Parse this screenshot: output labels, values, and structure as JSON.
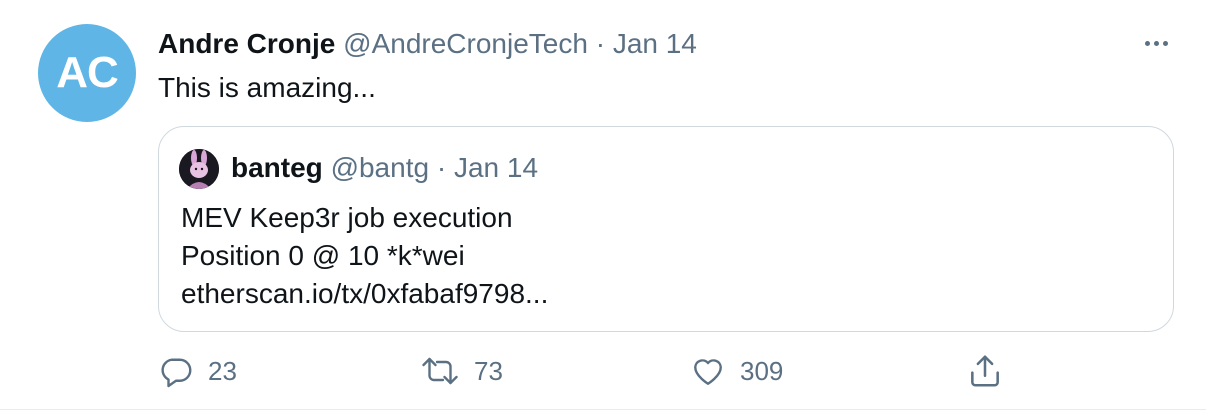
{
  "tweet": {
    "avatar_initials": "AC",
    "avatar_color": "#5fb5e5",
    "author_name": "Andre Cronje",
    "author_handle": "@AndreCronjeTech",
    "separator": "·",
    "date": "Jan 14",
    "text": "This is amazing..."
  },
  "quoted_tweet": {
    "avatar_icon": "bunny-avatar-icon",
    "author_name": "banteg",
    "author_handle": "@bantg",
    "separator": "·",
    "date": "Jan 14",
    "lines": [
      "MEV Keep3r job execution",
      "Position 0 @ 10 *k*wei",
      "etherscan.io/tx/0xfabaf9798..."
    ]
  },
  "actions": {
    "reply": {
      "icon": "reply-icon",
      "count": "23"
    },
    "retweet": {
      "icon": "retweet-icon",
      "count": "73"
    },
    "like": {
      "icon": "heart-icon",
      "count": "309"
    },
    "share": {
      "icon": "share-icon"
    }
  },
  "colors": {
    "text": "#0f1419",
    "secondary": "#5b7083",
    "border": "#cfd9de"
  }
}
